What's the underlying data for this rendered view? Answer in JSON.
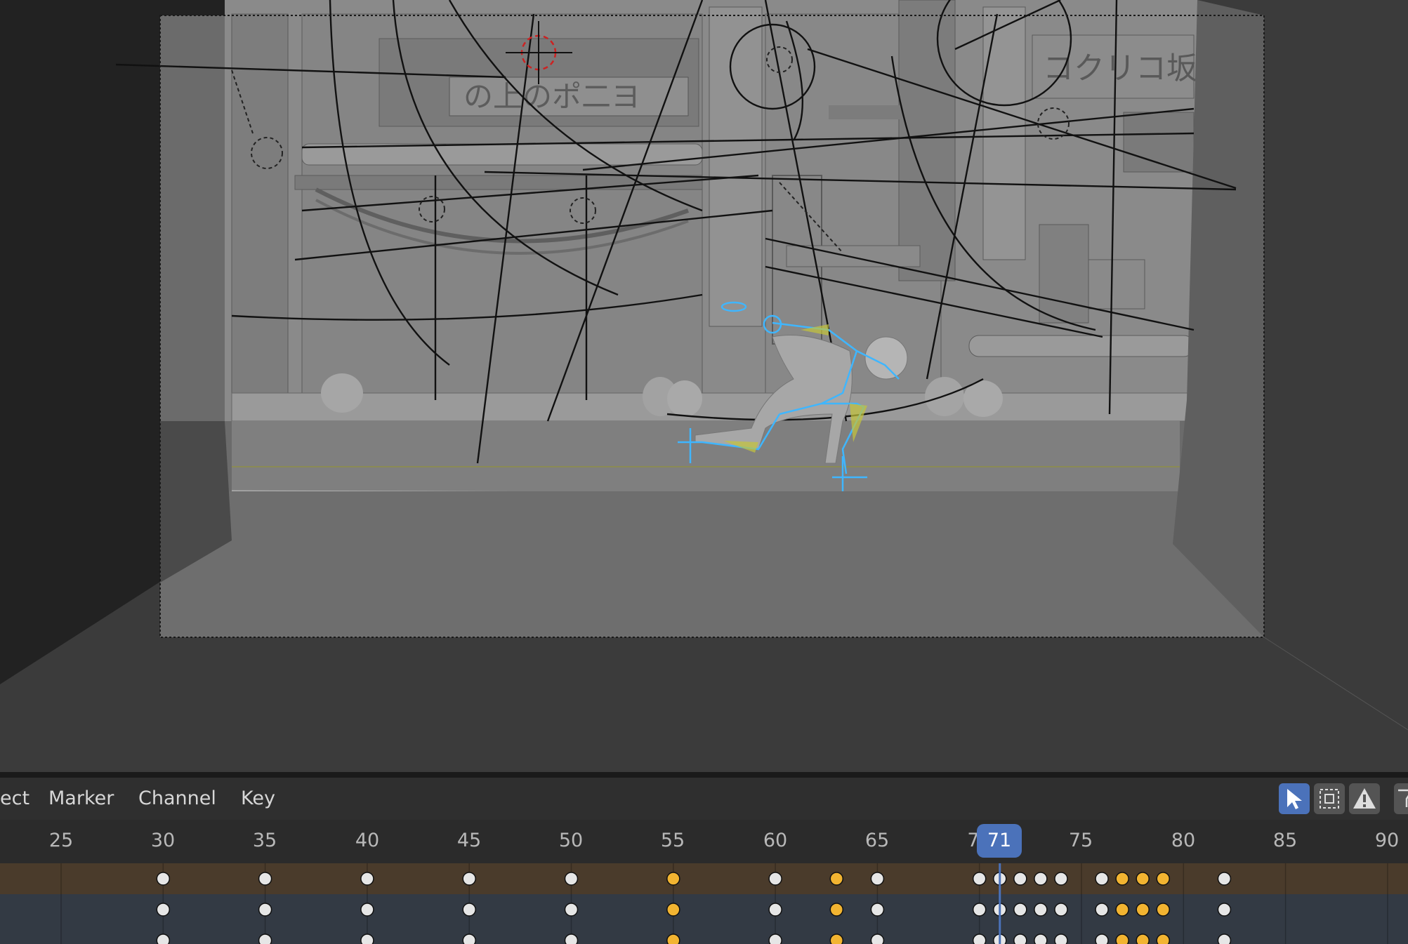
{
  "menu": {
    "select_partial": "ect",
    "marker": "Marker",
    "channel": "Channel",
    "key": "Key"
  },
  "icons": [
    "select-cursor-icon",
    "box-select-icon",
    "warning-icon",
    "filter-icon"
  ],
  "timeline": {
    "frame_ticks": [
      "25",
      "30",
      "35",
      "40",
      "45",
      "50",
      "55",
      "60",
      "65",
      "7",
      "75",
      "80",
      "85",
      "90"
    ],
    "current_frame": "71",
    "keyframes_white": [
      30,
      35,
      40,
      45,
      50,
      60,
      65,
      70,
      71,
      72,
      73,
      74,
      76,
      82
    ],
    "keyframes_selected": [
      55,
      63,
      77,
      78,
      79
    ]
  },
  "viewport_sign_text": [
    "の上のポ二ヨ",
    "コクリコ坂"
  ],
  "colors": {
    "accent": "#4b72ba",
    "keyframe_selected": "#f2b431",
    "keyframe": "#e6e6e6",
    "summary_row": "#4a3b2b",
    "channel_row": "#333a44"
  }
}
